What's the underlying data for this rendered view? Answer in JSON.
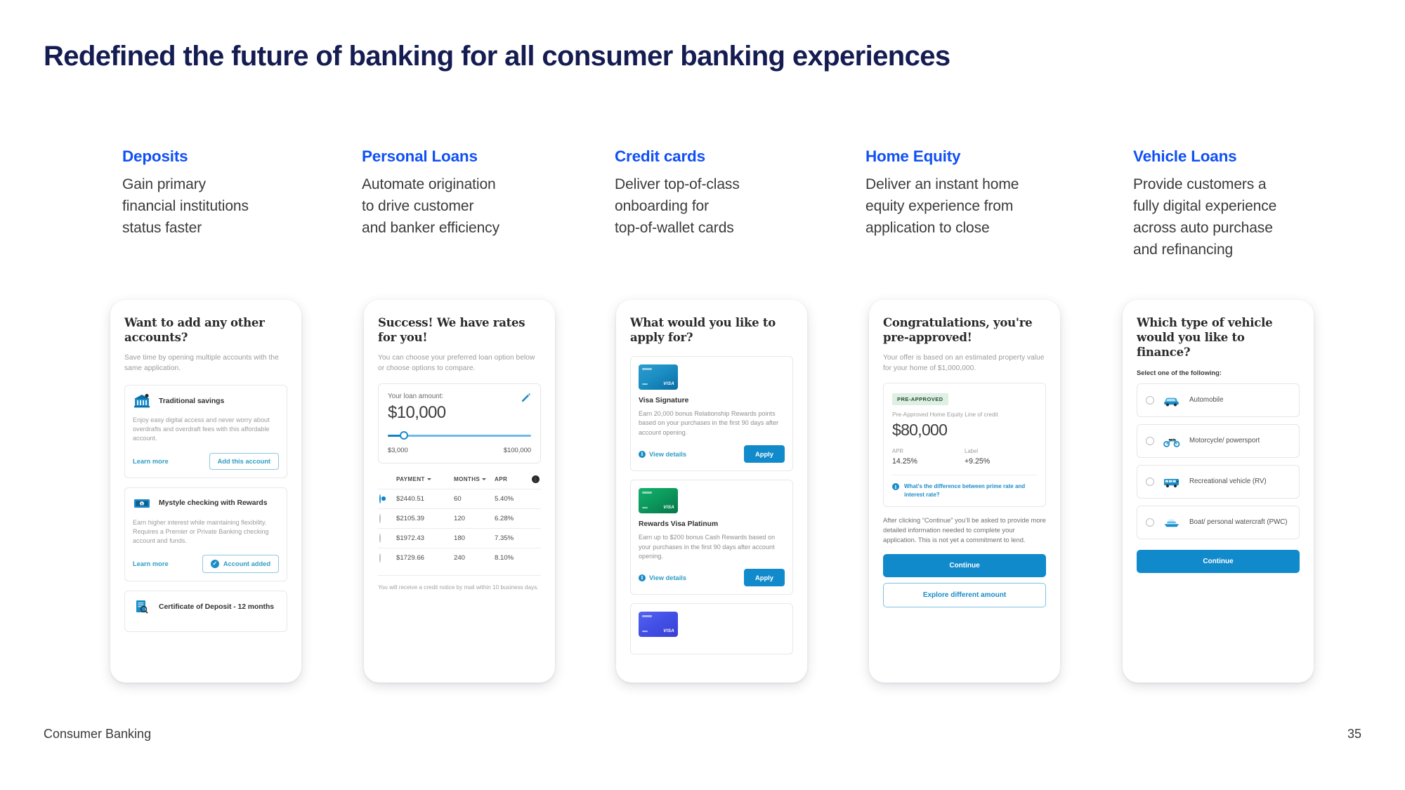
{
  "slide": {
    "title": "Redefined the future of banking for all consumer banking experiences",
    "footer_left": "Consumer Banking",
    "footer_page": "35",
    "accent_blue": "#1050f5",
    "title_navy": "#141c52",
    "primary_cta": "#118acb",
    "link_teal": "#2f9dc4"
  },
  "columns": [
    {
      "head": "Deposits",
      "desc": "Gain primary\nfinancial institutions\nstatus faster"
    },
    {
      "head": "Personal Loans",
      "desc": "Automate origination\nto drive customer\nand banker efficiency"
    },
    {
      "head": "Credit cards",
      "desc": "Deliver top-of-class\nonboarding for\ntop-of-wallet cards"
    },
    {
      "head": "Home Equity",
      "desc": "Deliver an instant home\nequity experience from\napplication to close"
    },
    {
      "head": "Vehicle Loans",
      "desc": "Provide customers a\nfully digital experience\nacross auto purchase\nand refinancing"
    }
  ],
  "deposits": {
    "title": "Want to add any other accounts?",
    "subtitle": "Save time by opening multiple accounts with the same application.",
    "accounts": [
      {
        "icon": "bank-icon",
        "name": "Traditional savings",
        "desc": "Enjoy easy digital access and never worry about overdrafts and overdraft fees with this affordable account.",
        "link": "Learn more",
        "action": "Add this account",
        "added": false
      },
      {
        "icon": "money-icon",
        "name": "Mystyle checking with Rewards",
        "desc": "Earn higher interest while maintaining flexibility. Requires a Premier or Private Banking checking account and funds.",
        "link": "Learn more",
        "action": "Account added",
        "added": true
      },
      {
        "icon": "document-search-icon",
        "name": "Certificate of Deposit - 12 months",
        "desc": "",
        "link": "",
        "action": "",
        "added": false
      }
    ]
  },
  "personal_loans": {
    "title": "Success! We have rates for you!",
    "subtitle": "You can choose your preferred loan option below or choose options to compare.",
    "amount_label": "Your loan amount:",
    "amount_value": "$10,000",
    "slider_min": "$3,000",
    "slider_max": "$100,000",
    "table_headers": [
      "PAYMENT",
      "MONTHS",
      "APR"
    ],
    "rows": [
      {
        "payment": "$2440.51",
        "months": "60",
        "apr": "5.40%",
        "selected": true
      },
      {
        "payment": "$2105.39",
        "months": "120",
        "apr": "6.28%",
        "selected": false
      },
      {
        "payment": "$1972.43",
        "months": "180",
        "apr": "7.35%",
        "selected": false
      },
      {
        "payment": "$1729.66",
        "months": "240",
        "apr": "8.10%",
        "selected": false
      }
    ],
    "note": "You will receive a credit notice by mail within 10 business days."
  },
  "credit_cards": {
    "title": "What would you like to apply for?",
    "cards": [
      {
        "name": "Visa Signature",
        "desc": "Earn 20,000 bonus Relationship Rewards points based on your purchases in the first 90 days after account opening.",
        "view": "View details",
        "apply": "Apply",
        "color_top": "#1f8fc4",
        "color_bottom": "#0b6ea5",
        "brand": "VISA"
      },
      {
        "name": "Rewards Visa Platinum",
        "desc": "Earn up to $200 bonus Cash Rewards based on your purchases in the first 90 days after account opening.",
        "view": "View details",
        "apply": "Apply",
        "color_top": "#0f9f62",
        "color_bottom": "#077a49",
        "brand": "VISA"
      },
      {
        "name": "",
        "desc": "",
        "view": "",
        "apply": "",
        "color_top": "#4257e8",
        "color_bottom": "#3b48d6",
        "brand": "VISA"
      }
    ]
  },
  "home_equity": {
    "title": "Congratulations, you're pre-approved!",
    "subtitle": "Your offer is based on an estimated property value for your home of $1,000,000.",
    "badge": "PRE-APPROVED",
    "offer_label": "Pre-Approved Home Equity Line of credit",
    "offer_amount": "$80,000",
    "apr_key": "APR",
    "apr_value": "14.25%",
    "label_key": "Label",
    "label_value": "+9.25%",
    "question": "What's the difference between prime rate and interest rate?",
    "note": "After clicking “Continue” you’ll be asked to provide more detailed information needed to complete your application. This is not yet a commitment to lend.",
    "primary_cta": "Continue",
    "secondary_cta": "Explore different amount"
  },
  "vehicle_loans": {
    "title": "Which type of vehicle would you like to finance?",
    "subtitle": "Select one of the following:",
    "options": [
      {
        "icon": "car-icon",
        "label": "Automobile"
      },
      {
        "icon": "motorcycle-icon",
        "label": "Motorcycle/ powersport"
      },
      {
        "icon": "rv-icon",
        "label": "Recreational vehicle (RV)"
      },
      {
        "icon": "boat-icon",
        "label": "Boat/ personal watercraft (PWC)"
      }
    ],
    "cta": "Continue"
  }
}
